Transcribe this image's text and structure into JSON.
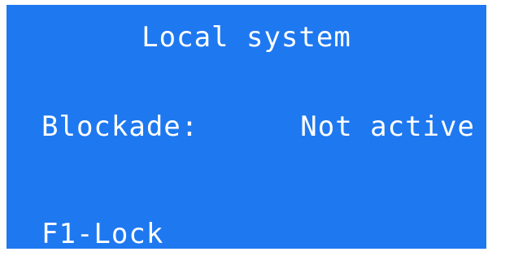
{
  "screen": {
    "title": "Local system",
    "status_label": "Blockade:",
    "status_value": "Not active",
    "softkey_f1": "F1-Lock"
  },
  "colors": {
    "display_background": "#1e78f0",
    "text": "#ffffff",
    "outer_background": "#ffffff"
  }
}
